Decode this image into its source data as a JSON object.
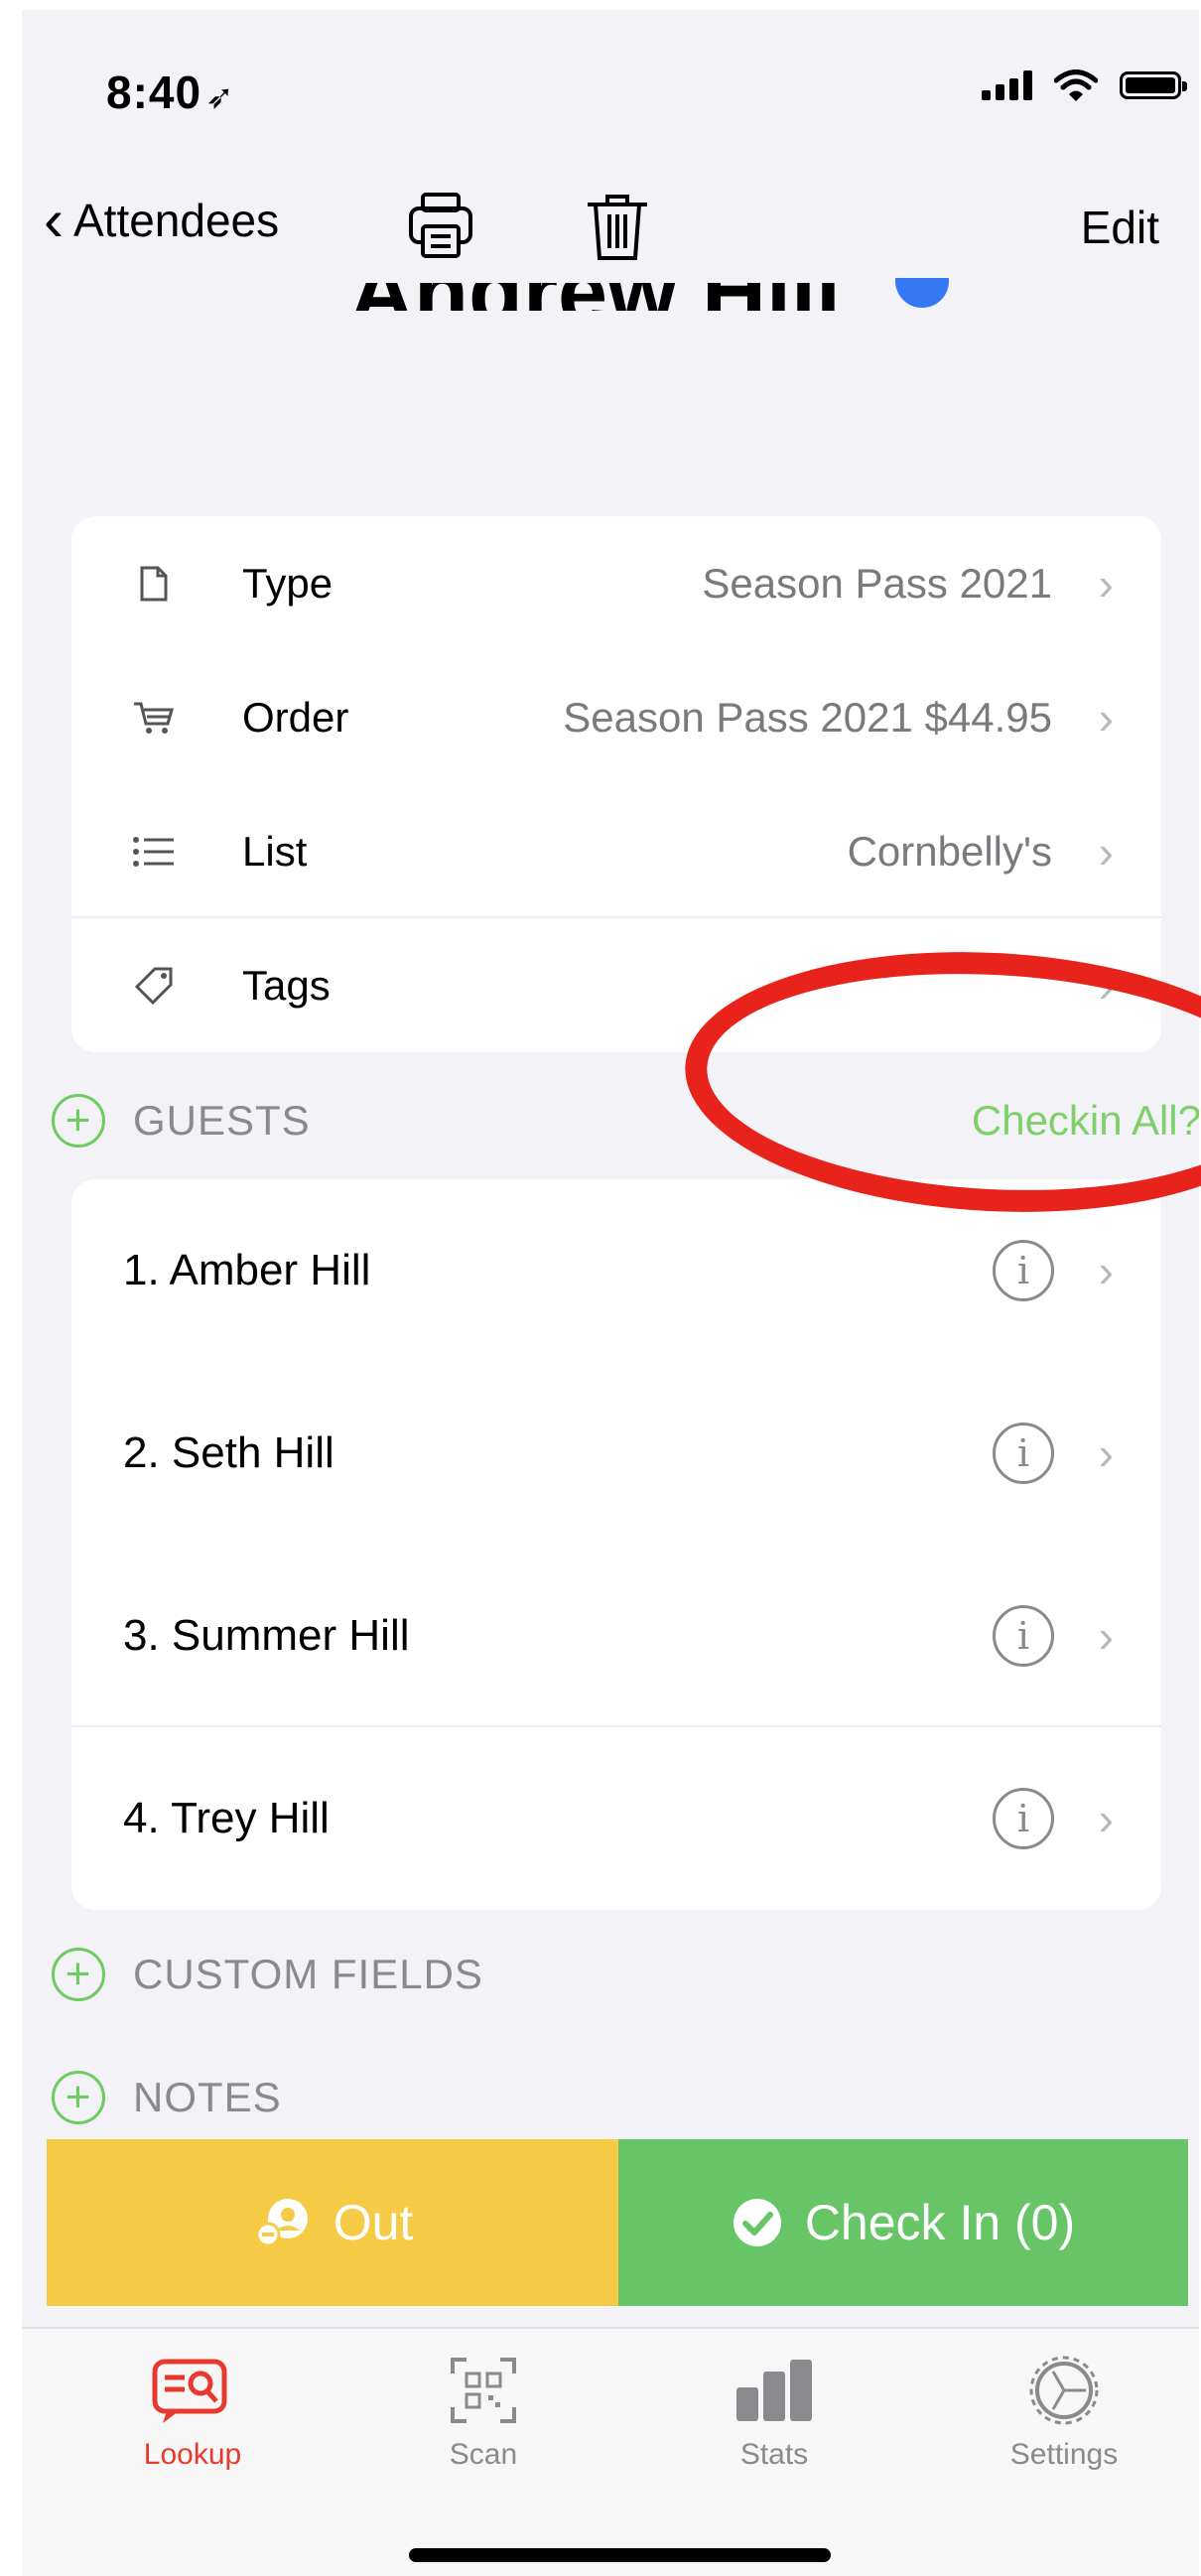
{
  "status_bar": {
    "time": "8:40",
    "location_arrow": "➶"
  },
  "nav": {
    "back_label": "Attendees",
    "edit_label": "Edit"
  },
  "header": {
    "name_clipped": "Andrew Hill"
  },
  "details": [
    {
      "icon": "document-icon",
      "label": "Type",
      "value": "Season Pass 2021"
    },
    {
      "icon": "cart-icon",
      "label": "Order",
      "value": "Season Pass 2021 $44.95"
    },
    {
      "icon": "list-icon",
      "label": "List",
      "value": "Cornbelly's"
    },
    {
      "icon": "tag-icon",
      "label": "Tags",
      "value": ""
    }
  ],
  "guests_section": {
    "title": "GUESTS",
    "action": "Checkin All?"
  },
  "guests": [
    {
      "name": "1. Amber Hill"
    },
    {
      "name": "2. Seth Hill"
    },
    {
      "name": "3. Summer Hill"
    },
    {
      "name": "4. Trey Hill"
    }
  ],
  "custom_fields_section": {
    "title": "CUSTOM FIELDS"
  },
  "notes_section": {
    "title": "NOTES"
  },
  "actions": {
    "out_label": "Out",
    "checkin_label": "Check In (0)"
  },
  "tabs": [
    {
      "label": "Lookup",
      "icon": "lookup-icon",
      "active": true
    },
    {
      "label": "Scan",
      "icon": "scan-icon",
      "active": false
    },
    {
      "label": "Stats",
      "icon": "stats-icon",
      "active": false
    },
    {
      "label": "Settings",
      "icon": "settings-icon",
      "active": false
    }
  ],
  "colors": {
    "accent_green": "#67c467",
    "out_yellow": "#f5cb45",
    "active_tab_red": "#e8392f",
    "annotation_red": "#e8231c"
  }
}
